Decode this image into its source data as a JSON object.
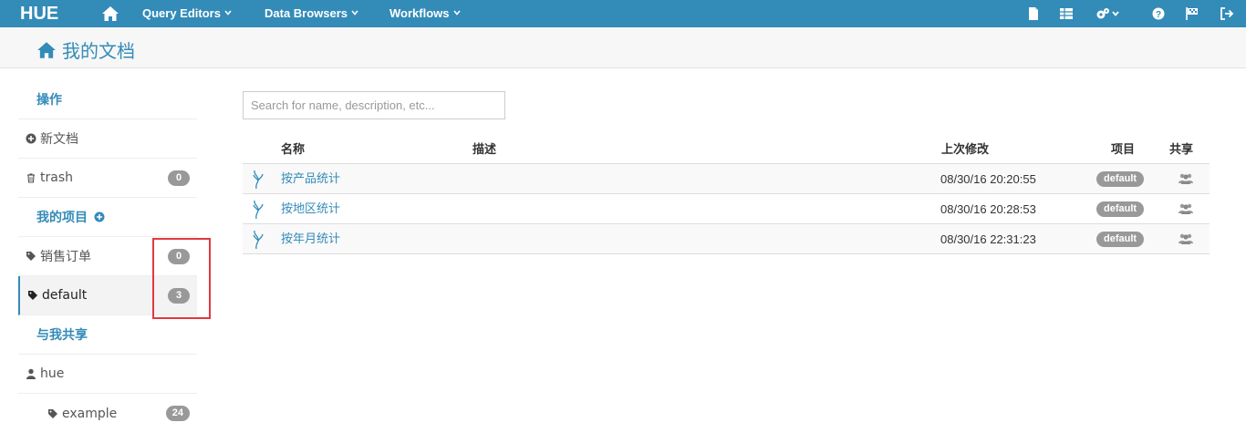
{
  "navbar": {
    "logo": "HUE",
    "menus": [
      {
        "label": "Query Editors"
      },
      {
        "label": "Data Browsers"
      },
      {
        "label": "Workflows"
      }
    ],
    "bg_color": "#338bb8",
    "right_icons": [
      "file-icon",
      "table-icon",
      "cogs-icon",
      "help-icon",
      "flag-icon",
      "sign-out-icon"
    ]
  },
  "page": {
    "title": "我的文档"
  },
  "sidebar": {
    "actions_header": "操作",
    "new_doc": "新文档",
    "trash": {
      "label": "trash",
      "count": "0"
    },
    "projects_header": "我的项目",
    "projects": [
      {
        "label": "销售订单",
        "count": "0"
      },
      {
        "label": "default",
        "count": "3"
      }
    ],
    "shared_header": "与我共享",
    "shared_user": "hue",
    "shared_projects": [
      {
        "label": "example",
        "count": "24"
      }
    ]
  },
  "search": {
    "placeholder": "Search for name, description, etc..."
  },
  "table": {
    "headers": {
      "name": "名称",
      "description": "描述",
      "modified": "上次修改",
      "project": "项目",
      "share": "共享"
    },
    "rows": [
      {
        "name": "按产品统计",
        "description": "",
        "modified": "08/30/16 20:20:55",
        "project": "default"
      },
      {
        "name": "按地区统计",
        "description": "",
        "modified": "08/30/16 20:28:53",
        "project": "default"
      },
      {
        "name": "按年月统计",
        "description": "",
        "modified": "08/30/16 22:31:23",
        "project": "default"
      }
    ]
  },
  "colors": {
    "accent": "#338bb8",
    "badge": "#999999",
    "highlight": "#e0393e"
  }
}
